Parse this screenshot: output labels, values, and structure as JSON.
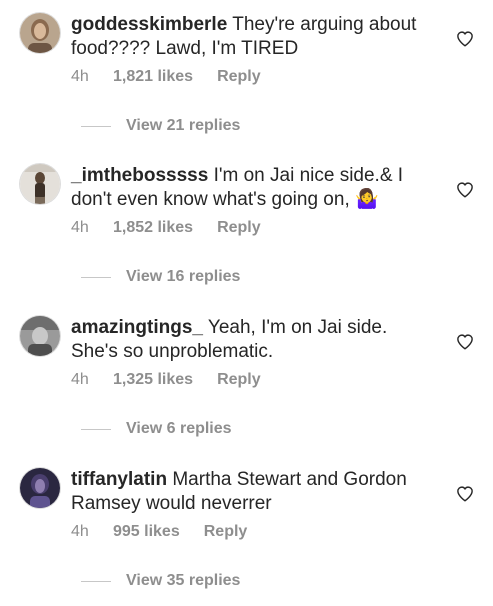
{
  "comments": [
    {
      "username": "goddesskimberle",
      "text": " They're arguing about food???? Lawd, I'm TIRED",
      "time": "4h",
      "likes": "1,821 likes",
      "reply": "Reply",
      "view_replies": "View 21 replies"
    },
    {
      "username": "_imthebosssss",
      "text": " I'm on Jai nice side.& I don't even know what's going on, 🤷‍♀️",
      "time": "4h",
      "likes": "1,852 likes",
      "reply": "Reply",
      "view_replies": "View 16 replies"
    },
    {
      "username": "amazingtings_",
      "text": " Yeah, I'm on Jai side. She's so unproblematic.",
      "time": "4h",
      "likes": "1,325 likes",
      "reply": "Reply",
      "view_replies": "View 6 replies"
    },
    {
      "username": "tiffanylatin",
      "text": " Martha Stewart and Gordon Ramsey would neverrer",
      "time": "4h",
      "likes": "995 likes",
      "reply": "Reply",
      "view_replies": "View 35 replies"
    }
  ],
  "icons": {
    "heart": "heart-outline-icon"
  }
}
